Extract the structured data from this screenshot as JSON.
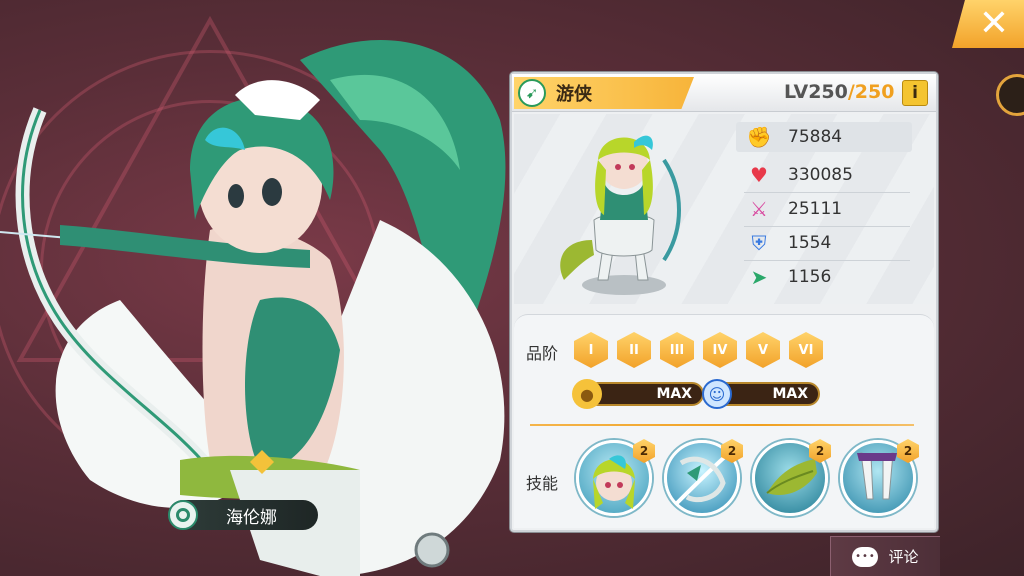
{
  "hero": {
    "name": "海伦娜",
    "class_name": "游侠",
    "level": "LV250",
    "level_max": "/250",
    "info_label": "i"
  },
  "stats": {
    "power": "75884",
    "hp": "330085",
    "attack": "25111",
    "defense": "1554",
    "speed": "1156"
  },
  "advancement": {
    "label": "品阶",
    "tiers": [
      "I",
      "II",
      "III",
      "IV",
      "V",
      "VI"
    ],
    "gold_max": "MAX",
    "spirit_max": "MAX"
  },
  "skills": {
    "label": "技能",
    "items": [
      {
        "level": "2",
        "icon": "skill-portrait-icon"
      },
      {
        "level": "2",
        "icon": "skill-bow-icon"
      },
      {
        "level": "2",
        "icon": "skill-tail-icon"
      },
      {
        "level": "2",
        "icon": "skill-legs-icon"
      }
    ]
  },
  "footer": {
    "comment_label": "评论"
  },
  "close_label": "✕",
  "colors": {
    "accent": "#f2a22a",
    "class_green": "#2a9a5a",
    "panel_bg": "#eef0f2"
  }
}
